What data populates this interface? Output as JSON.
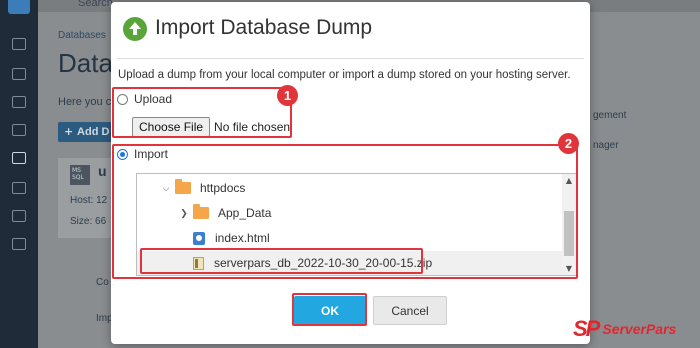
{
  "background": {
    "search_text": "Search",
    "breadcrumb": "Databases",
    "page_title": "Data",
    "intro_text": "Here you c",
    "add_button": "Add D",
    "db_badge": "MS SQL",
    "db_name": "u",
    "host_label": "Host: 12",
    "size_label": "Size: 66",
    "right_text_1": "gement",
    "right_text_2": "nager",
    "row_1": "Co",
    "row_2": "Imp"
  },
  "dialog": {
    "title": "Import Database Dump",
    "description": "Upload a dump from your local computer or import a dump stored on your hosting server.",
    "upload_label": "Upload",
    "choose_file_label": "Choose File",
    "no_file_text": "No file chosen",
    "import_label": "Import",
    "selected_option": "Import",
    "tree": [
      {
        "name": "httpdocs",
        "type": "folder",
        "expanded": true
      },
      {
        "name": "App_Data",
        "type": "folder",
        "expanded": false
      },
      {
        "name": "index.html",
        "type": "html-file"
      },
      {
        "name": "serverpars_db_2022-10-30_20-00-15.zip",
        "type": "zip-file",
        "selected": true
      }
    ],
    "ok_label": "OK",
    "cancel_label": "Cancel"
  },
  "annotations": {
    "badge_1": "1",
    "badge_2": "2",
    "highlight_color": "#e0353b"
  },
  "watermark": {
    "logo_text": "SP",
    "name": "ServerPars"
  },
  "colors": {
    "ok_button": "#22a7e0",
    "icon_green": "#5aa53a",
    "folder": "#f5a64a"
  }
}
